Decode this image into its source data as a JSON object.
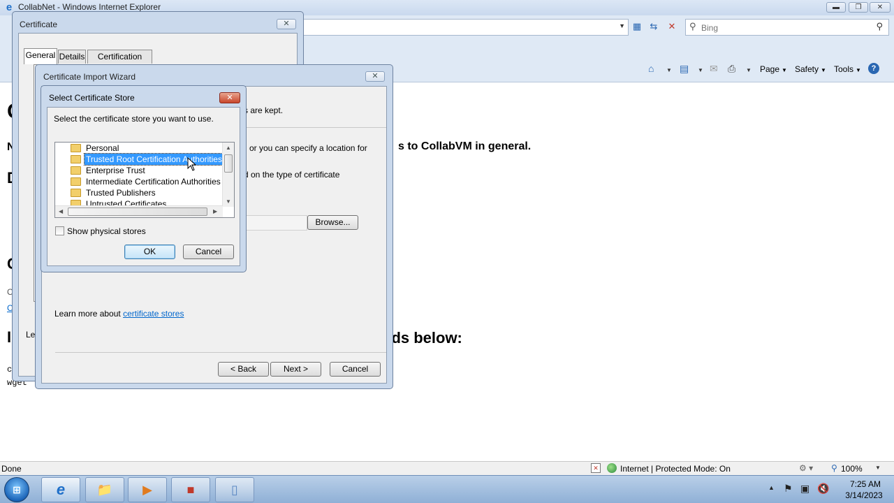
{
  "ie": {
    "title": "CollabNet - Windows Internet Explorer",
    "search_placeholder": "Bing",
    "commands": {
      "page": "Page",
      "safety": "Safety",
      "tools": "Tools"
    }
  },
  "page": {
    "headings": [
      "C",
      "N",
      "D",
      "C",
      "I"
    ],
    "line1_tail": "s to CollabVM in general.",
    "line2_tail": "nds below:",
    "code_prefix": "c",
    "code_line": "wget",
    "left_fragments": [
      "C",
      "C"
    ]
  },
  "status": {
    "text": "Done",
    "zone": "Internet | Protected Mode: On",
    "zoom": "100%"
  },
  "taskbar": {
    "time": "7:25 AM",
    "date": "3/14/2023",
    "items": [
      "internet-explorer",
      "explorer-folder",
      "media-player",
      "toolbox",
      "document"
    ]
  },
  "certificate_dialog": {
    "title": "Certificate",
    "tabs": [
      "General",
      "Details",
      "Certification Path"
    ],
    "active_tab": "General",
    "footer_fragment": "Le"
  },
  "import_wizard": {
    "title": "Certificate Import Wizard",
    "text_kept": "s are kept.",
    "text_specify": "or you can specify a location for",
    "text_type": "d on the type of certificate",
    "browse_label": "Browse...",
    "learn_more": "Learn more about",
    "learn_more_link": "certificate stores",
    "back_label": "< Back",
    "next_label": "Next >",
    "cancel_label": "Cancel"
  },
  "select_store": {
    "title": "Select Certificate Store",
    "prompt": "Select the certificate store you want to use.",
    "stores": [
      "Personal",
      "Trusted Root Certification Authorities",
      "Enterprise Trust",
      "Intermediate Certification Authorities",
      "Trusted Publishers",
      "Untrusted Certificates"
    ],
    "selected_index": 1,
    "show_physical_label": "Show physical stores",
    "show_physical_checked": false,
    "ok_label": "OK",
    "cancel_label": "Cancel"
  }
}
